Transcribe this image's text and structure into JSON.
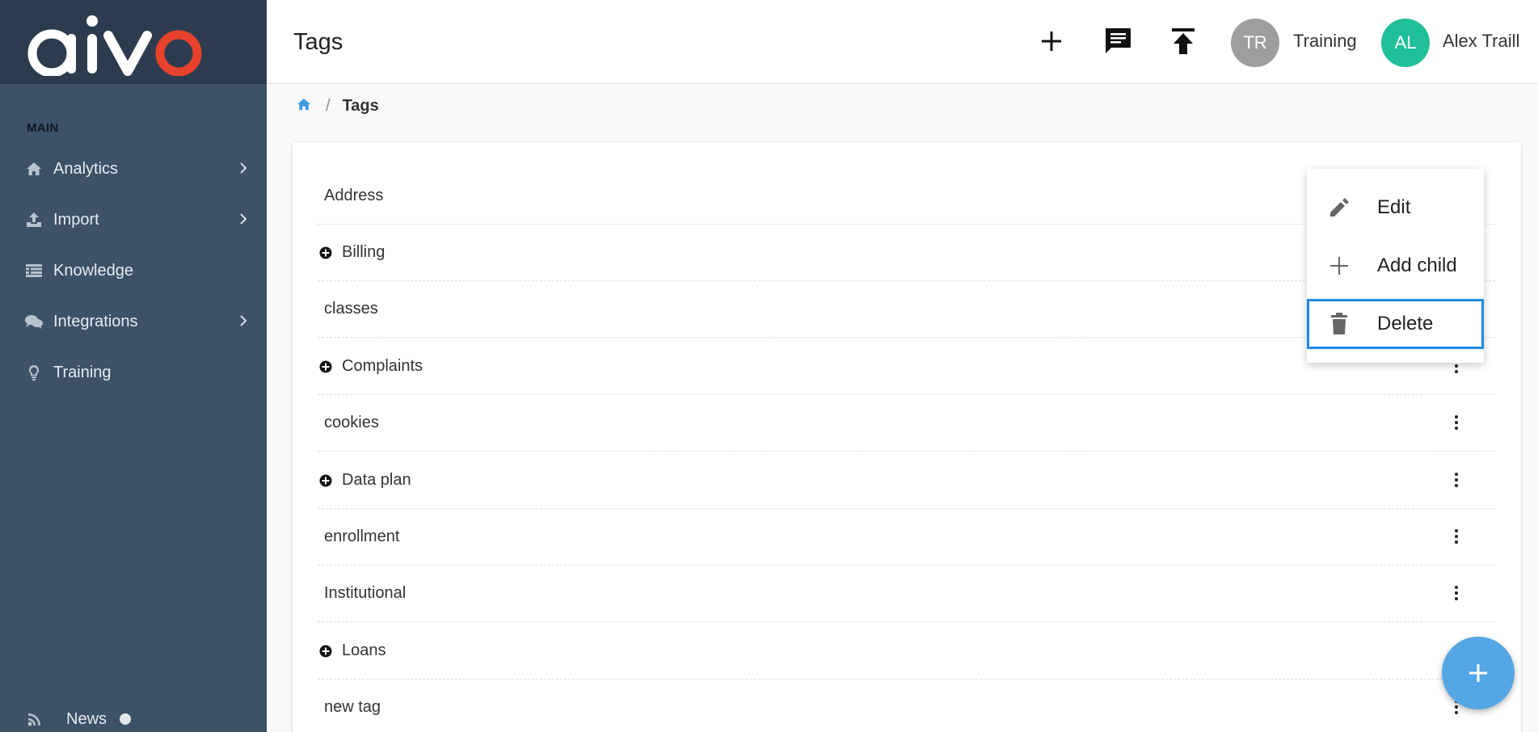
{
  "brand": {
    "logo_text": "aivo"
  },
  "sidebar": {
    "section_label": "MAIN",
    "items": [
      {
        "label": "Analytics",
        "icon": "home-icon",
        "has_submenu": true
      },
      {
        "label": "Import",
        "icon": "upload-icon",
        "has_submenu": true
      },
      {
        "label": "Knowledge",
        "icon": "list-icon",
        "has_submenu": false
      },
      {
        "label": "Integrations",
        "icon": "comments-icon",
        "has_submenu": true
      },
      {
        "label": "Training",
        "icon": "lightbulb-icon",
        "has_submenu": false
      }
    ],
    "news": {
      "label": "News",
      "icon": "rss-icon"
    }
  },
  "header": {
    "title": "Tags",
    "actions": [
      "add-icon",
      "message-icon",
      "publish-icon"
    ],
    "workspace": {
      "initials": "TR",
      "name": "Training",
      "color": "#9e9e9e"
    },
    "user": {
      "initials": "AL",
      "name": "Alex Traill",
      "color": "#1fbf9a"
    }
  },
  "breadcrumb": {
    "home_icon": "home-icon",
    "separator": "/",
    "current": "Tags"
  },
  "tags": [
    {
      "label": "Address",
      "expandable": false
    },
    {
      "label": "Billing",
      "expandable": true
    },
    {
      "label": "classes",
      "expandable": false
    },
    {
      "label": "Complaints",
      "expandable": true
    },
    {
      "label": "cookies",
      "expandable": false
    },
    {
      "label": "Data plan",
      "expandable": true
    },
    {
      "label": "enrollment",
      "expandable": false
    },
    {
      "label": "Institutional",
      "expandable": false
    },
    {
      "label": "Loans",
      "expandable": true
    },
    {
      "label": "new tag",
      "expandable": false
    }
  ],
  "context_menu": {
    "items": [
      {
        "label": "Edit",
        "icon": "pencil-icon"
      },
      {
        "label": "Add child",
        "icon": "plus-icon"
      },
      {
        "label": "Delete",
        "icon": "trash-icon",
        "focused": true
      }
    ]
  },
  "fab": {
    "icon": "plus-icon",
    "color": "#54a7e4"
  },
  "colors": {
    "sidebar": "#3d5167",
    "logo_bg": "#2c3c4e",
    "accent": "#54a7e4",
    "logo_o": "#e8412c",
    "focus": "#1e88e5"
  }
}
